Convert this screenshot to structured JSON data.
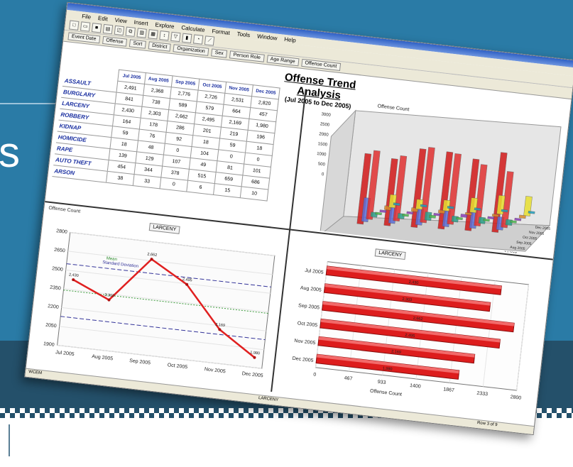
{
  "slide": {
    "side_text": "s"
  },
  "app": {
    "menu": [
      "File",
      "Edit",
      "View",
      "Insert",
      "Explore",
      "Calculate",
      "Format",
      "Tools",
      "Window",
      "Help"
    ],
    "filters": [
      "Event Date",
      "Offense",
      "Sort",
      "District",
      "Organization",
      "Sex",
      "Person Role",
      "Age Range",
      "Offense Count"
    ],
    "report_title": "Offense Trend Analysis",
    "report_subtitle": "(Jul 2005 to Dec 2005)",
    "status_left": "WCEM",
    "status_mid": "LARCENY",
    "status_right": "Row 3 of 9"
  },
  "table": {
    "columns": [
      "Jul 2005",
      "Aug 2005",
      "Sep 2005",
      "Oct 2005",
      "Nov 2005",
      "Dec 2005"
    ],
    "rows": [
      {
        "label": "ASSAULT",
        "values": [
          "2,491",
          "2,368",
          "2,776",
          "2,726",
          "2,531",
          "2,820"
        ]
      },
      {
        "label": "BURGLARY",
        "values": [
          "841",
          "738",
          "589",
          "579",
          "664",
          "457"
        ]
      },
      {
        "label": "LARCENY",
        "values": [
          "2,430",
          "2,303",
          "2,662",
          "2,495",
          "2,169",
          "1,980"
        ]
      },
      {
        "label": "ROBBERY",
        "values": [
          "164",
          "178",
          "286",
          "201",
          "219",
          "196"
        ]
      },
      {
        "label": "KIDNAP",
        "values": [
          "59",
          "76",
          "92",
          "18",
          "59",
          "18"
        ]
      },
      {
        "label": "HOMICIDE",
        "values": [
          "18",
          "48",
          "0",
          "104",
          "0",
          "0"
        ]
      },
      {
        "label": "RAPE",
        "values": [
          "139",
          "129",
          "107",
          "49",
          "81",
          "101"
        ]
      },
      {
        "label": "AUTO THEFT",
        "values": [
          "454",
          "344",
          "378",
          "515",
          "659",
          "686"
        ]
      },
      {
        "label": "ARSON",
        "values": [
          "38",
          "33",
          "0",
          "6",
          "15",
          "10"
        ]
      }
    ]
  },
  "chart_3d": {
    "ylabel": "Offense Count",
    "yticks": [
      "3000",
      "2500",
      "2000",
      "1500",
      "1000",
      "500",
      "0"
    ],
    "xticks": [
      "Jul 2005",
      "Aug 2005",
      "Sep 2005",
      "Oct 2005",
      "Nov 2005",
      "Dec 2005"
    ]
  },
  "chart_data": [
    {
      "type": "line",
      "ylabel": "Offense Count",
      "filter": "LARCENY",
      "legend": [
        "Mean",
        "Standard Deviation"
      ],
      "categories": [
        "Jul 2005",
        "Aug 2005",
        "Sep 2005",
        "Oct 2005",
        "Nov 2005",
        "Dec 2005"
      ],
      "yticks": [
        2800,
        2650,
        2500,
        2350,
        2200,
        2050,
        1900
      ],
      "ylim": [
        1900,
        2800
      ],
      "values": [
        2430,
        2303,
        2662,
        2495,
        2169,
        1980
      ],
      "labels": [
        "2,430",
        "2,303",
        "2,662",
        "2,495",
        "2,169",
        "1,980"
      ]
    },
    {
      "type": "bar",
      "orientation": "horizontal",
      "filter": "LARCENY",
      "xlabel": "Offense Count",
      "categories": [
        "Jul 2005",
        "Aug 2005",
        "Sep 2005",
        "Oct 2005",
        "Nov 2005",
        "Dec 2005"
      ],
      "xticks": [
        0,
        467,
        933,
        1400,
        1867,
        2333,
        2800
      ],
      "xlim": [
        0,
        2800
      ],
      "values": [
        2430,
        2303,
        2662,
        2495,
        2169,
        1980
      ],
      "labels": [
        "2,430",
        "2,303",
        "2,662",
        "2,495",
        "2,169",
        "1,980"
      ]
    }
  ],
  "colors": {
    "slide_blue": "#2a7ba6",
    "slide_dark": "#24506a",
    "bar_red": "#dd1d1d",
    "line_red": "#e02020",
    "label_blue": "#1a2fa0"
  }
}
